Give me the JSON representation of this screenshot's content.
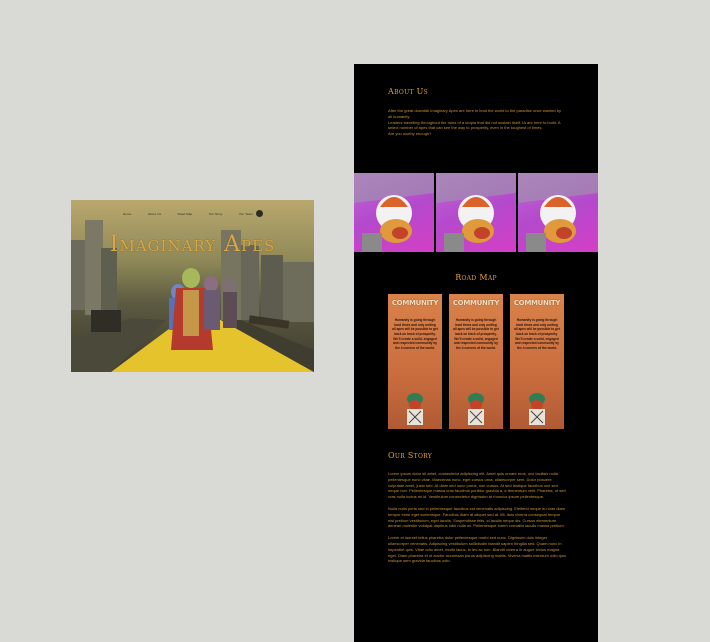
{
  "hero": {
    "nav": [
      "Home",
      "About Us",
      "Road Map",
      "Our Story",
      "Our Team"
    ],
    "title": "Imaginary Apes",
    "subtitle": "",
    "social_icon": "discord-icon"
  },
  "about": {
    "title": "About Us",
    "paragraphs": [
      "After the great downfall Imaginary Apes are here to lead the world to the paradise once wanted by all humanity.",
      "Leaders travelling throughout the ruins of a utopia that did not sustain itself, IA are here to build. A select number of apes that can see the way to prosperity, even in the toughest of times.",
      "Are you worthy enough?"
    ]
  },
  "banners": [
    "ape-banner-1",
    "ape-banner-2",
    "ape-banner-3"
  ],
  "roadmap": {
    "title": "Road Map",
    "cards": [
      {
        "title": "COMMUNITY",
        "text": "Humanity is going through hard times and only uniting all apes will be possible to get back on track of prosperity. We'll create a solid, engaged and respected community by the 4 corners of the world."
      },
      {
        "title": "COMMUNITY",
        "text": "Humanity is going through hard times and only uniting all apes will be possible to get back on track of prosperity. We'll create a solid, engaged and respected community by the 4 corners of the world."
      },
      {
        "title": "COMMUNITY",
        "text": "Humanity is going through hard times and only uniting all apes will be possible to get back on track of prosperity. We'll create a solid, engaged and respected community by the 4 corners of the world."
      }
    ]
  },
  "story": {
    "title": "Our Story",
    "paragraphs": [
      "Lorem ipsum dolor sit amet, consectetur adipiscing elit. Amet quis ornare eros, orci facilisis nulla pellentesque nunc vitae. Maecenas nunc, eget cursus urna, ullamcorper sem. Dolor posuere vulputate amet, justo sed. At diam sed nunc purus, non cursus. At sed tristique faucibus orci sed neque non. Pellentesque massa cras faucibus porttitor gravida a, a fermentum velit. Pharetra, ut sed cras nulla luctus mi id. Vestibulum consectetur dignissim at rhoncus ipsum pellentesque.",
      "Nulla nulla porta sed in pellentesque faucibus est venenatis adipiscing. Eleifend neque eu cras diam tempor enim eget scelerisque. Faucibus diam at aliquet sed at. Mi, duis viverra consequat tempor nisl pretium vestibulum, eget iaculis. Suspendisse felis, id iaculis neque dis. Cursus elementum aenean molestie volutpat dapibus nibh nulla mi. Pellentesque lorem convallis iaculis massa pretium.",
      "Lorem et laoreet tellus pharetra dolor pellentesque morbi sed nunc. Dignissim duis integer ullamcorper venenatis. Adipiscing vestibulum sollicitudin blandit sapien fringilla sed. Quam nunc in imperdiet quis. Vitae odio amet, morbi lacus, in leo ac non. Blandit viverra in augue lectus magna eget. Diam pharetra et ut auctor accumsan purus adipiscing mattis. Viverra mattis interdum odio quis tristique sem gravida faucibus odio."
    ]
  },
  "colors": {
    "page_bg": "#d9dad5",
    "panel_bg": "#000000",
    "accent": "#e2a43a",
    "body_text": "#c8943a",
    "card_bg": "#c96d3e",
    "banner_bg": "#c06ad6"
  }
}
